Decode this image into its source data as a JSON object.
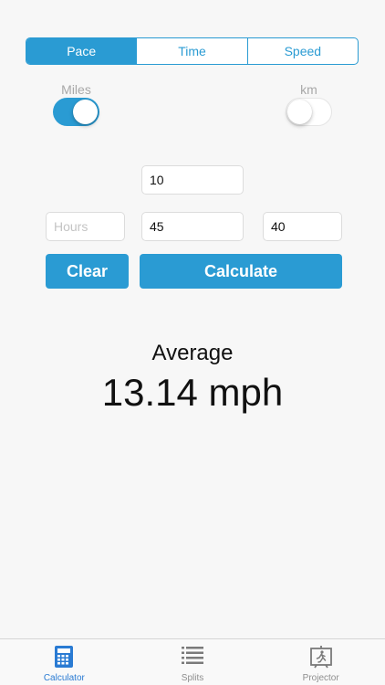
{
  "segments": [
    {
      "label": "Pace",
      "active": true
    },
    {
      "label": "Time",
      "active": false
    },
    {
      "label": "Speed",
      "active": false
    }
  ],
  "units": {
    "miles_label": "Miles",
    "miles_on": true,
    "km_label": "km",
    "km_on": false
  },
  "inputs": {
    "distance": {
      "value": "10",
      "placeholder": ""
    },
    "hours": {
      "value": "",
      "placeholder": "Hours"
    },
    "minutes": {
      "value": "45",
      "placeholder": ""
    },
    "seconds": {
      "value": "40",
      "placeholder": ""
    }
  },
  "buttons": {
    "clear_label": "Clear",
    "calculate_label": "Calculate"
  },
  "result": {
    "label": "Average",
    "value": "13.14 mph"
  },
  "tabbar": {
    "items": [
      {
        "label": "Calculator",
        "icon": "calculator-icon",
        "active": true
      },
      {
        "label": "Splits",
        "icon": "list-icon",
        "active": false
      },
      {
        "label": "Projector",
        "icon": "projector-icon",
        "active": false
      }
    ]
  },
  "colors": {
    "accent": "#2a9bd3",
    "tab_active": "#2a7bd3",
    "tab_inactive": "#8e8e8e",
    "background": "#f7f7f7"
  }
}
